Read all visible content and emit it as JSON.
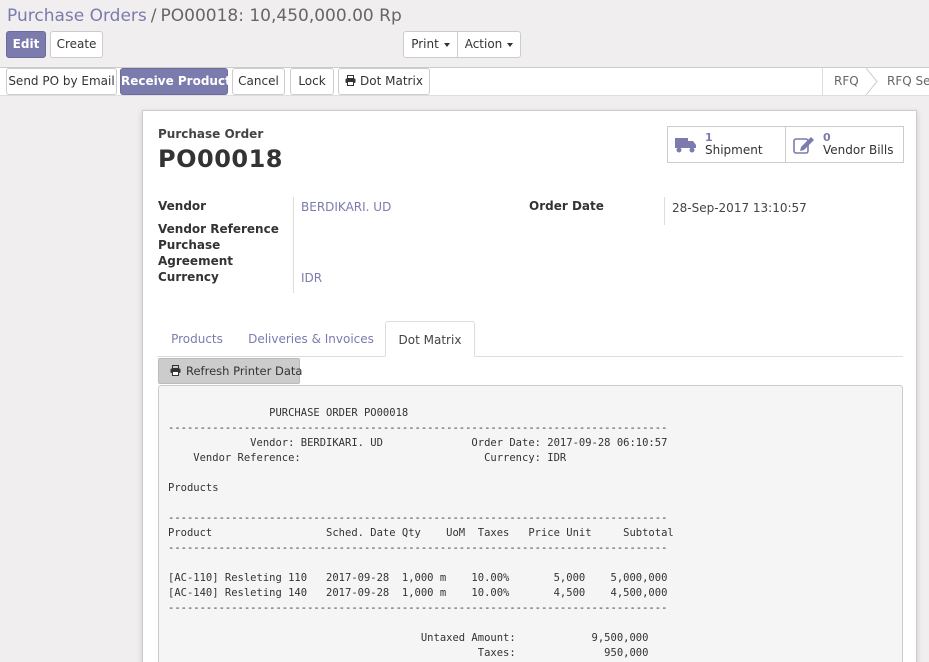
{
  "breadcrumb": {
    "parent": "Purchase Orders",
    "separator": "/",
    "current": "PO00018: 10,450,000.00 Rp"
  },
  "control_panel": {
    "edit_label": "Edit",
    "create_label": "Create",
    "print_label": "Print",
    "action_label": "Action"
  },
  "statusbar": {
    "buttons": {
      "send_po": "Send PO by Email",
      "receive": "Receive Products",
      "cancel": "Cancel",
      "lock": "Lock",
      "dot_matrix": "Dot Matrix"
    },
    "stages": [
      "RFQ",
      "RFQ Ser"
    ]
  },
  "form": {
    "doc_type": "Purchase Order",
    "name": "PO00018",
    "smart_buttons": [
      {
        "count": "1",
        "label": "Shipment",
        "icon": "truck-icon"
      },
      {
        "count": "0",
        "label": "Vendor Bills",
        "icon": "pencil-square-icon"
      }
    ],
    "fields": {
      "vendor_label": "Vendor",
      "vendor_value": "BERDIKARI. UD",
      "vendor_ref_label": "Vendor Reference",
      "purchase_label": "Purchase",
      "agreement_label": "Agreement",
      "currency_label": "Currency",
      "currency_value": "IDR",
      "order_date_label": "Order Date",
      "order_date_value": "28-Sep-2017 13:10:57"
    },
    "tabs": [
      "Products",
      "Deliveries & Invoices",
      "Dot Matrix"
    ],
    "active_tab": "Dot Matrix",
    "refresh_label": "Refresh Printer Data",
    "printer_text": "                PURCHASE ORDER PO00018\n-------------------------------------------------------------------------------\n             Vendor: BERDIKARI. UD              Order Date: 2017-09-28 06:10:57\n    Vendor Reference:                             Currency: IDR\n\nProducts\n\n-------------------------------------------------------------------------------\nProduct                  Sched. Date Qty    UoM  Taxes   Price Unit     Subtotal\n-------------------------------------------------------------------------------\n\n[AC-110] Resleting 110   2017-09-28  1,000 m    10.00%       5,000    5,000,000\n[AC-140] Resleting 140   2017-09-28  1,000 m    10.00%       4,500    4,500,000\n-------------------------------------------------------------------------------\n\n                                        Untaxed Amount:            9,500,000\n                                                 Taxes:              950,000"
  }
}
